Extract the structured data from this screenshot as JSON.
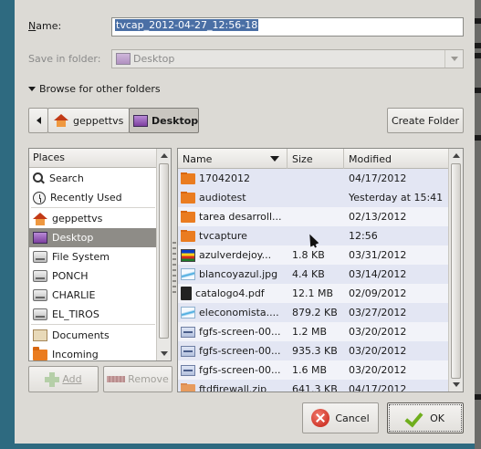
{
  "dialog": {
    "name_label": "Name:",
    "name_value": "tvcap_2012-04-27_12:56-18",
    "save_in_label": "Save in folder:",
    "save_in_value": "Desktop",
    "browse_label": "Browse for other folders",
    "create_folder_label": "Create Folder"
  },
  "breadcrumb": {
    "items": [
      {
        "label": "geppettvs",
        "icon": "home-icon"
      },
      {
        "label": "Desktop",
        "icon": "desktop-icon",
        "active": true
      }
    ]
  },
  "places": {
    "header": "Places",
    "items": [
      {
        "label": "Search",
        "icon": "search-icon"
      },
      {
        "label": "Recently Used",
        "icon": "recent-icon"
      },
      {
        "label": "geppettvs",
        "icon": "home-icon"
      },
      {
        "label": "Desktop",
        "icon": "desktop-icon",
        "selected": true
      },
      {
        "label": "File System",
        "icon": "drive-icon"
      },
      {
        "label": "PONCH",
        "icon": "drive-icon"
      },
      {
        "label": "CHARLIE",
        "icon": "drive-icon"
      },
      {
        "label": "EL_TIROS",
        "icon": "drive-icon"
      },
      {
        "label": "Documents",
        "icon": "folder-icon"
      },
      {
        "label": "Incoming",
        "icon": "folder-icon"
      }
    ],
    "add_label": "Add",
    "remove_label": "Remove"
  },
  "files": {
    "columns": {
      "name": "Name",
      "size": "Size",
      "modified": "Modified"
    },
    "rows": [
      {
        "name": "17042012",
        "size": "",
        "modified": "04/17/2012",
        "icon": "folder-icon"
      },
      {
        "name": "audiotest",
        "size": "",
        "modified": "Yesterday at 15:41",
        "icon": "folder-icon"
      },
      {
        "name": "tarea desarroll...",
        "size": "",
        "modified": "02/13/2012",
        "icon": "folder-icon"
      },
      {
        "name": "tvcapture",
        "size": "",
        "modified": "12:56",
        "icon": "folder-icon"
      },
      {
        "name": "azulverdejoy...",
        "size": "1.8 KB",
        "modified": "03/31/2012",
        "icon": "image-icon"
      },
      {
        "name": "blancoyazul.jpg",
        "size": "4.4 KB",
        "modified": "03/14/2012",
        "icon": "image-icon"
      },
      {
        "name": "catalogo4.pdf",
        "size": "12.1 MB",
        "modified": "02/09/2012",
        "icon": "pdf-icon"
      },
      {
        "name": "eleconomista....",
        "size": "879.2 KB",
        "modified": "03/27/2012",
        "icon": "image-icon"
      },
      {
        "name": "fgfs-screen-00...",
        "size": "1.2 MB",
        "modified": "03/20/2012",
        "icon": "screenshot-icon"
      },
      {
        "name": "fgfs-screen-00...",
        "size": "935.3 KB",
        "modified": "03/20/2012",
        "icon": "screenshot-icon"
      },
      {
        "name": "fgfs-screen-00...",
        "size": "1.6 MB",
        "modified": "03/20/2012",
        "icon": "screenshot-icon"
      },
      {
        "name": "ftdfirewall.zip",
        "size": "641.3 KB",
        "modified": "04/17/2012",
        "icon": "folder-icon"
      }
    ]
  },
  "buttons": {
    "cancel_label": "Cancel",
    "ok_label": "OK"
  },
  "colors": {
    "selection": "#4a6fa5",
    "folder": "#ea7c20",
    "row_alt": "#e3e6f3",
    "place_selected": "#8e8c87"
  }
}
